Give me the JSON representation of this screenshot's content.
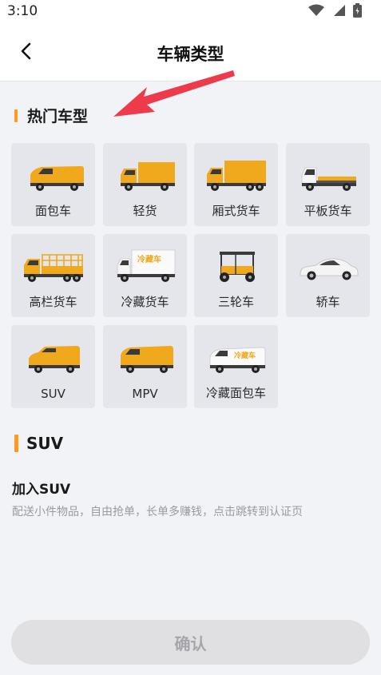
{
  "status_bar": {
    "time": "3:10",
    "icons": [
      "wifi-icon",
      "cellular-signal-icon",
      "battery-icon"
    ]
  },
  "header": {
    "title": "车辆类型",
    "back_icon": "chevron-left-icon"
  },
  "hot_section": {
    "title": "热门车型",
    "vehicles": [
      {
        "label": "面包车",
        "icon": "van-icon"
      },
      {
        "label": "轻货",
        "icon": "light-truck-icon"
      },
      {
        "label": "厢式货车",
        "icon": "box-truck-icon"
      },
      {
        "label": "平板货车",
        "icon": "flatbed-truck-icon"
      },
      {
        "label": "高栏货车",
        "icon": "high-fence-truck-icon"
      },
      {
        "label": "冷藏货车",
        "icon": "refrigerated-truck-icon"
      },
      {
        "label": "三轮车",
        "icon": "tricycle-icon"
      },
      {
        "label": "轿车",
        "icon": "sedan-icon"
      },
      {
        "label": "SUV",
        "icon": "suv-icon"
      },
      {
        "label": "MPV",
        "icon": "mpv-icon"
      },
      {
        "label": "冷藏面包车",
        "icon": "refrigerated-van-icon"
      }
    ],
    "truck_decal_text": "冷藏车"
  },
  "selected_section": {
    "title": "SUV",
    "join_title": "加入SUV",
    "join_desc": "配送小件物品，自由抢单，长单多赚钱，点击跳转到认证页"
  },
  "footer": {
    "confirm_label": "确认"
  },
  "colors": {
    "accent": "#ff9a1f",
    "vehicle_yellow": "#f0a81c",
    "annotation_red": "#ee3b4b",
    "button_disabled_bg": "#e0e0e3",
    "button_disabled_text": "#a6a6aa"
  }
}
